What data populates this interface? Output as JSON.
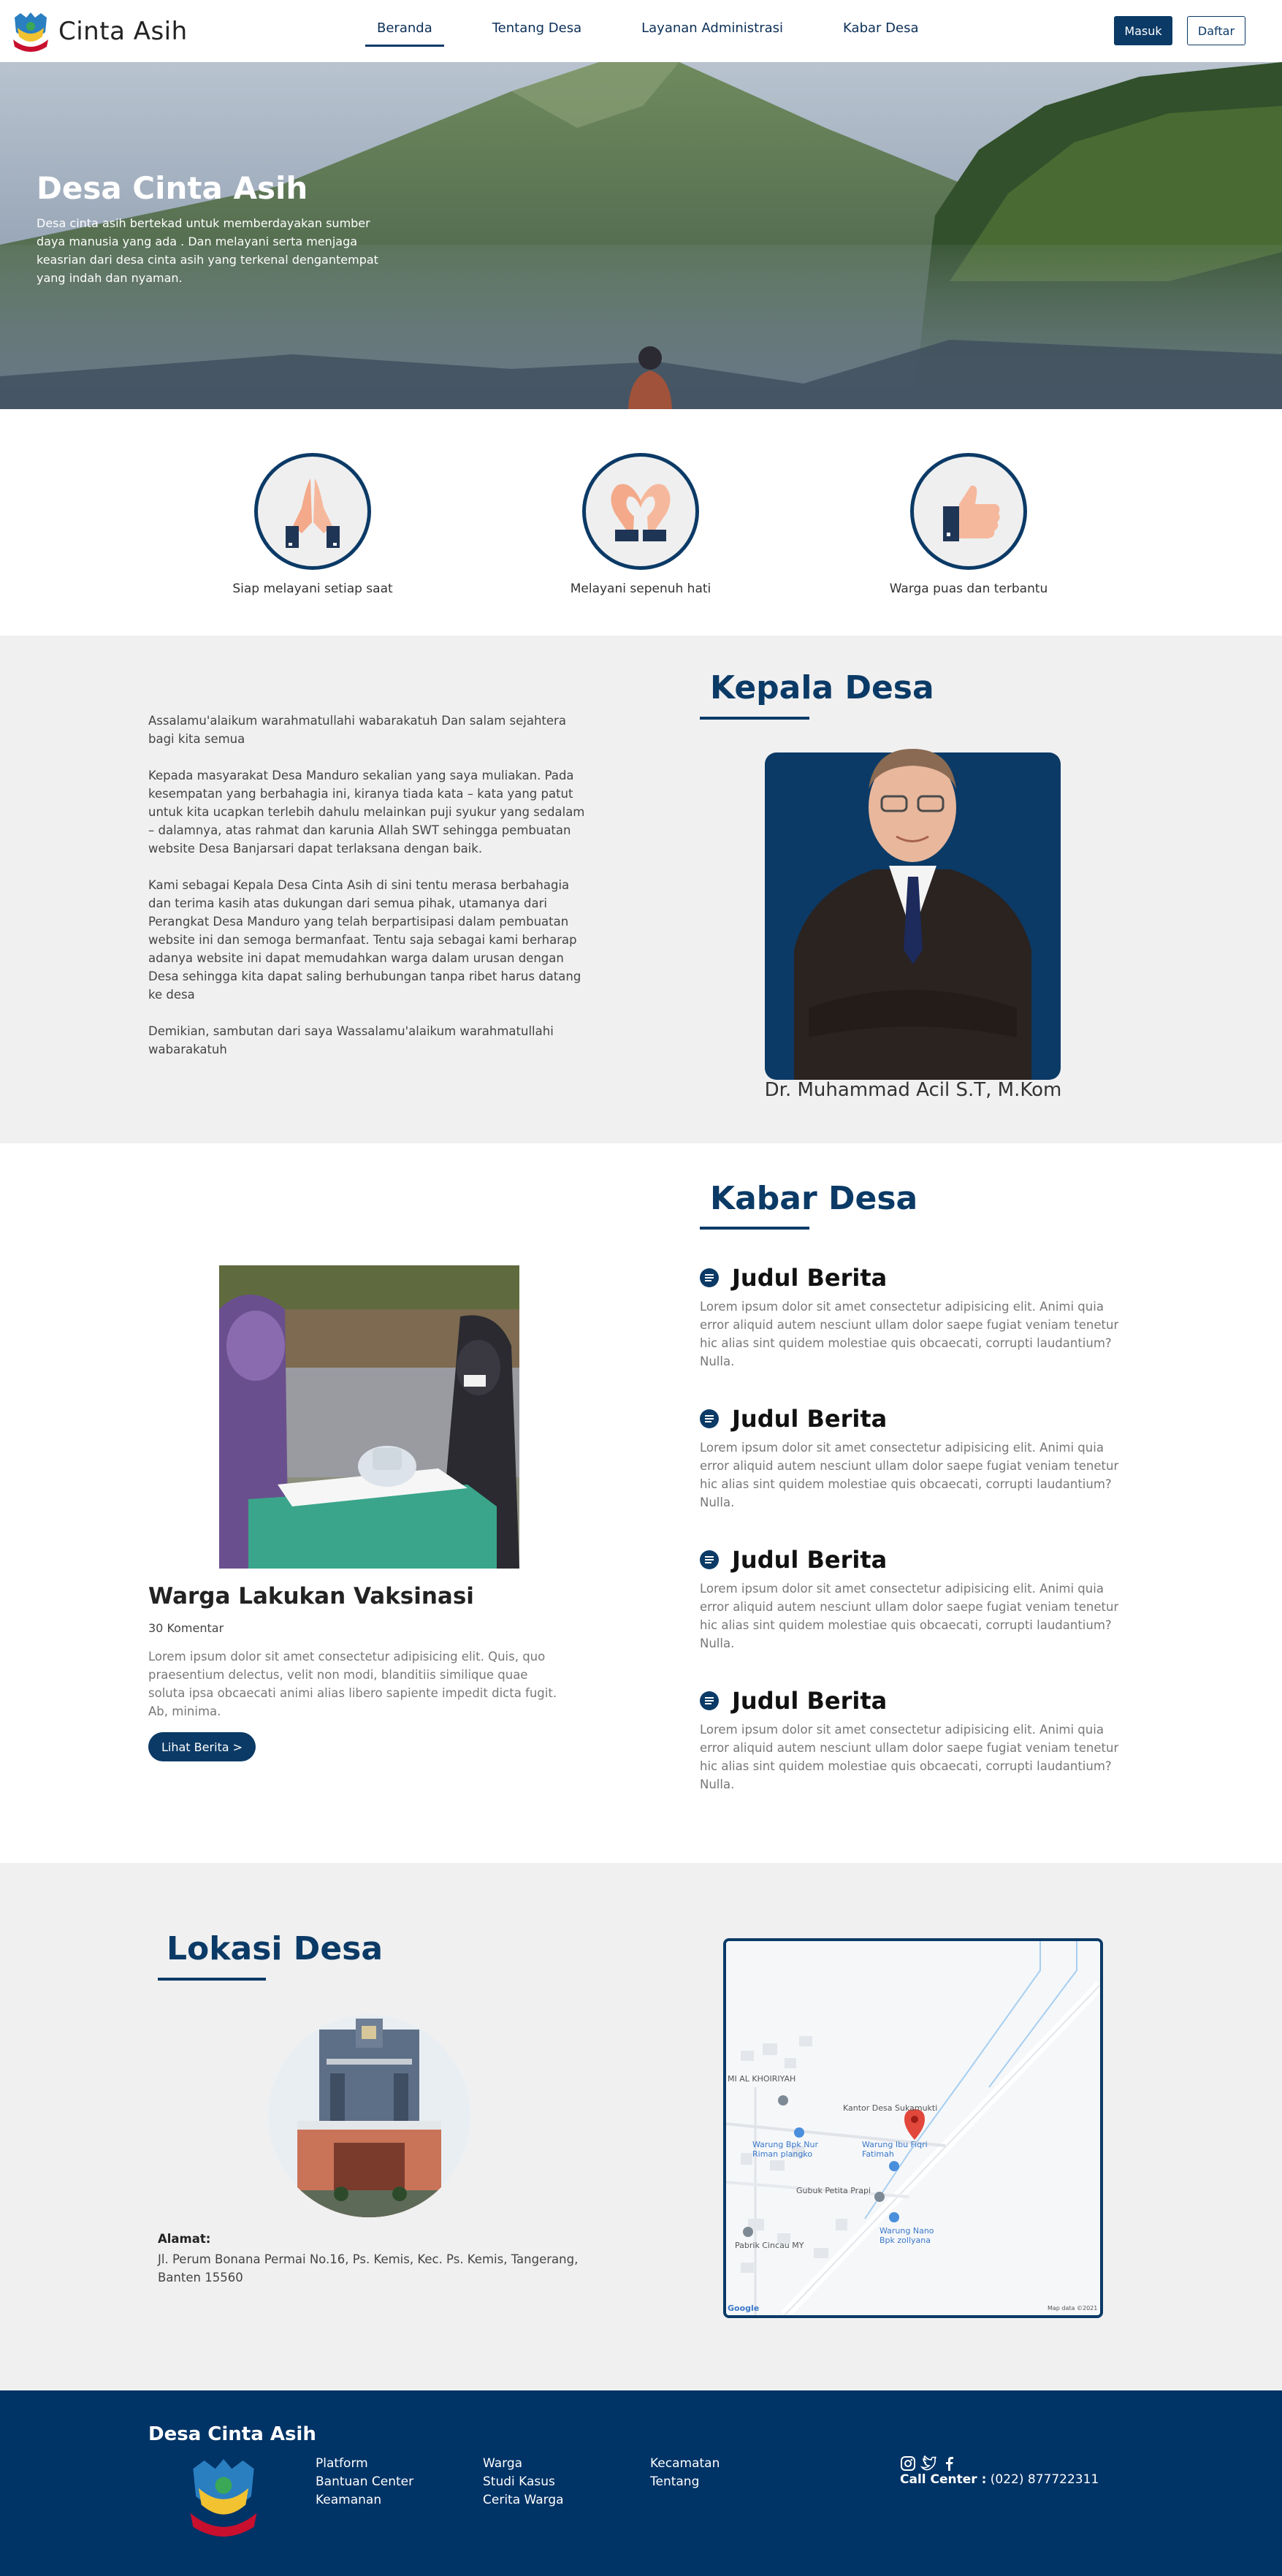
{
  "navbar": {
    "brand": "Cinta Asih",
    "links": [
      "Beranda",
      "Tentang Desa",
      "Layanan Administrasi",
      "Kabar Desa"
    ],
    "login": "Masuk",
    "register": "Daftar"
  },
  "hero": {
    "title": "Desa Cinta Asih",
    "description": "Desa cinta asih bertekad untuk memberdayakan sumber daya manusia yang ada . Dan melayani serta menjaga keasrian dari desa cinta asih yang terkenal dengantempat yang indah dan nyaman."
  },
  "features": [
    {
      "label": "Siap melayani setiap saat",
      "icon": "praying-hands-icon"
    },
    {
      "label": "Melayani sepenuh hati",
      "icon": "heart-hands-icon"
    },
    {
      "label": "Warga puas dan terbantu",
      "icon": "thumbs-up-icon"
    }
  ],
  "kepala": {
    "heading": "Kepala Desa",
    "paragraphs": [
      "Assalamu'alaikum warahmatullahi wabarakatuh Dan salam sejahtera bagi kita semua",
      "Kepada masyarakat Desa Manduro sekalian yang saya muliakan. Pada kesempatan yang berbahagia ini, kiranya tiada kata – kata yang patut untuk kita ucapkan terlebih dahulu melainkan puji syukur yang sedalam – dalamnya, atas rahmat dan karunia Allah SWT sehingga pembuatan website Desa Banjarsari dapat terlaksana dengan baik.",
      "Kami sebagai Kepala Desa Cinta Asih di sini tentu merasa berbahagia dan terima kasih atas dukungan dari semua pihak, utamanya dari Perangkat Desa Manduro yang telah berpartisipasi dalam pembuatan website ini dan semoga bermanfaat. Tentu saja sebagai kami berharap adanya website ini dapat memudahkan warga dalam urusan dengan Desa sehingga kita dapat saling berhubungan tanpa ribet harus datang ke desa",
      "Demikian, sambutan dari saya Wassalamu'alaikum warahmatullahi wabarakatuh"
    ],
    "name": "Dr. Muhammad Acil S.T, M.Kom"
  },
  "kabar": {
    "heading": "Kabar Desa",
    "featured": {
      "title": "Warga Lakukan Vaksinasi",
      "comments": "30 Komentar",
      "body": "Lorem ipsum dolor sit amet consectetur adipisicing elit. Quis, quo praesentium delectus, velit non modi, blanditiis similique quae soluta ipsa obcaecati animi alias libero sapiente impedit dicta fugit. Ab, minima.",
      "button": "Lihat Berita >"
    },
    "items": [
      {
        "title": "Judul Berita",
        "text": "Lorem ipsum dolor sit amet consectetur adipisicing elit. Animi quia error aliquid autem nesciunt ullam dolor saepe fugiat veniam tenetur hic alias sint quidem molestiae quis obcaecati, corrupti laudantium? Nulla."
      },
      {
        "title": "Judul Berita",
        "text": "Lorem ipsum dolor sit amet consectetur adipisicing elit. Animi quia error aliquid autem nesciunt ullam dolor saepe fugiat veniam tenetur hic alias sint quidem molestiae quis obcaecati, corrupti laudantium? Nulla."
      },
      {
        "title": "Judul Berita",
        "text": "Lorem ipsum dolor sit amet consectetur adipisicing elit. Animi quia error aliquid autem nesciunt ullam dolor saepe fugiat veniam tenetur hic alias sint quidem molestiae quis obcaecati, corrupti laudantium? Nulla."
      },
      {
        "title": "Judul Berita",
        "text": "Lorem ipsum dolor sit amet consectetur adipisicing elit. Animi quia error aliquid autem nesciunt ullam dolor saepe fugiat veniam tenetur hic alias sint quidem molestiae quis obcaecati, corrupti laudantium? Nulla."
      }
    ]
  },
  "lokasi": {
    "heading": "Lokasi Desa",
    "address_label": "Alamat:",
    "address": "Jl. Perum Bonana Permai No.16, Ps. Kemis, Kec. Ps. Kemis, Tangerang, Banten 15560",
    "map_labels": [
      "MI AL KHOIRIYAH",
      "Kantor Desa Sukamukti",
      "Warung Bpk Nur Riman plangko",
      "Warung Ibu Fiqri Fatimah",
      "Gubuk Petita Prapi",
      "Warung Nano Bpk zollyana",
      "Pabrik Cincau MY",
      "Google",
      "Map data ©2021"
    ]
  },
  "footer": {
    "title": "Desa Cinta Asih",
    "col1": [
      "Platform",
      "Bantuan Center",
      "Keamanan"
    ],
    "col2": [
      "Warga",
      "Studi Kasus",
      "Cerita Warga"
    ],
    "col3": [
      "Kecamatan",
      "Tentang"
    ],
    "social": [
      "instagram-icon",
      "twitter-icon",
      "facebook-icon"
    ],
    "callcenter_label": "Call Center :",
    "callcenter_number": " (022) 877722311"
  },
  "colors": {
    "primary": "#0b3a66",
    "footer": "#003366",
    "section_bg": "#f0f0f0"
  }
}
